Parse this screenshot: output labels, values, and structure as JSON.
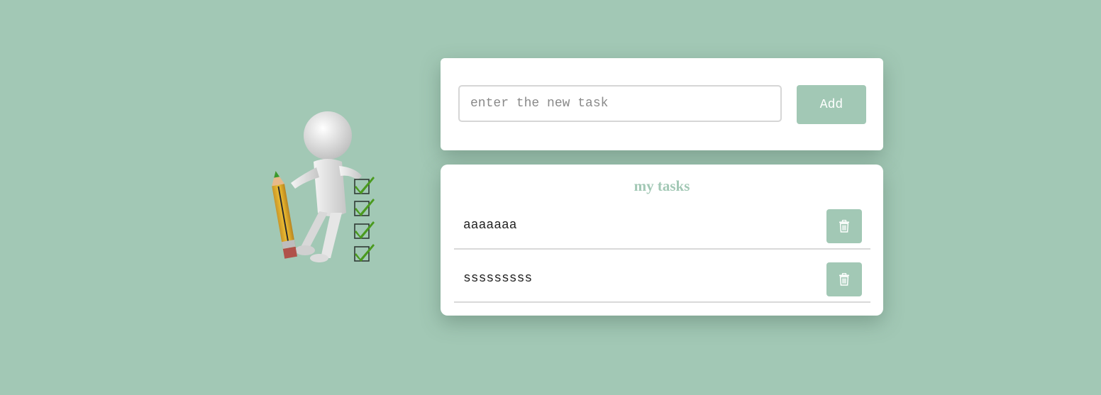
{
  "new_task": {
    "placeholder": "enter the new task",
    "value": "",
    "add_label": "Add"
  },
  "task_list": {
    "title": "my tasks",
    "items": [
      {
        "text": "aaaaaaa",
        "delete_icon": "trash-icon"
      },
      {
        "text": "sssssssss",
        "delete_icon": "trash-icon"
      }
    ]
  },
  "colors": {
    "background": "#a2c8b5",
    "accent": "#a2c8b5",
    "card": "#ffffff"
  },
  "illustration": {
    "icon": "figure-with-pencil-and-checklist-icon"
  }
}
